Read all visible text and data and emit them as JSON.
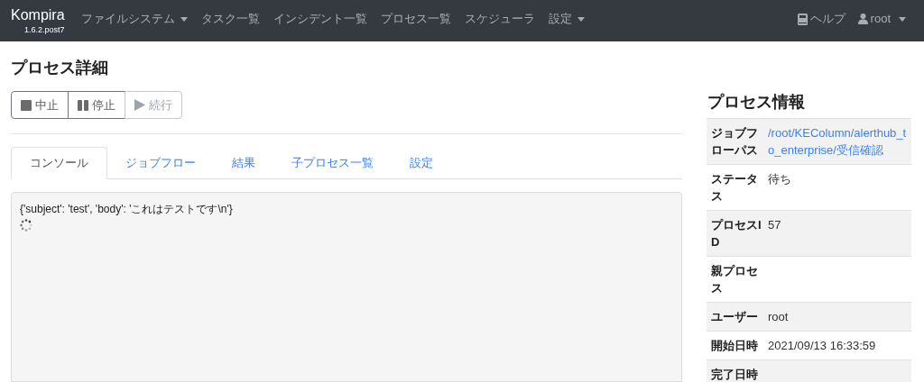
{
  "navbar": {
    "brand": "Kompira",
    "version": "1.6.2.post7",
    "items": [
      {
        "label": "ファイルシステム",
        "dropdown": true
      },
      {
        "label": "タスク一覧",
        "dropdown": false
      },
      {
        "label": "インシデント一覧",
        "dropdown": false
      },
      {
        "label": "プロセス一覧",
        "dropdown": false
      },
      {
        "label": "スケジューラ",
        "dropdown": false
      },
      {
        "label": "設定",
        "dropdown": true
      }
    ],
    "help": "ヘルプ",
    "user": "root"
  },
  "page_title": "プロセス詳細",
  "actions": [
    {
      "kind": "stop",
      "label": "中止",
      "disabled": false
    },
    {
      "kind": "pause",
      "label": "停止",
      "disabled": false
    },
    {
      "kind": "resume",
      "label": "続行",
      "disabled": true
    }
  ],
  "tabs": [
    {
      "label": "コンソール",
      "selected": true
    },
    {
      "label": "ジョブフロー",
      "selected": false
    },
    {
      "label": "結果",
      "selected": false
    },
    {
      "label": "子プロセス一覧",
      "selected": false
    },
    {
      "label": "設定",
      "selected": false
    }
  ],
  "console": {
    "output": "{'subject': 'test', 'body': 'これはテストです\\n'}",
    "loading": true
  },
  "info": {
    "title": "プロセス情報",
    "rows": [
      {
        "label": "ジョブフローパス",
        "value": "/root/KEColumn/alerthub_to_enterprise/受信確認",
        "link": true
      },
      {
        "label": "ステータス",
        "value": "待ち",
        "link": false
      },
      {
        "label": "プロセスID",
        "value": "57",
        "link": false
      },
      {
        "label": "親プロセス"
      },
      {
        "label": "ユーザー",
        "value": "root",
        "link": false
      },
      {
        "label": "開始日時",
        "value": "2021/09/13 16:33:59",
        "link": false
      },
      {
        "label": "完了日時"
      }
    ]
  }
}
